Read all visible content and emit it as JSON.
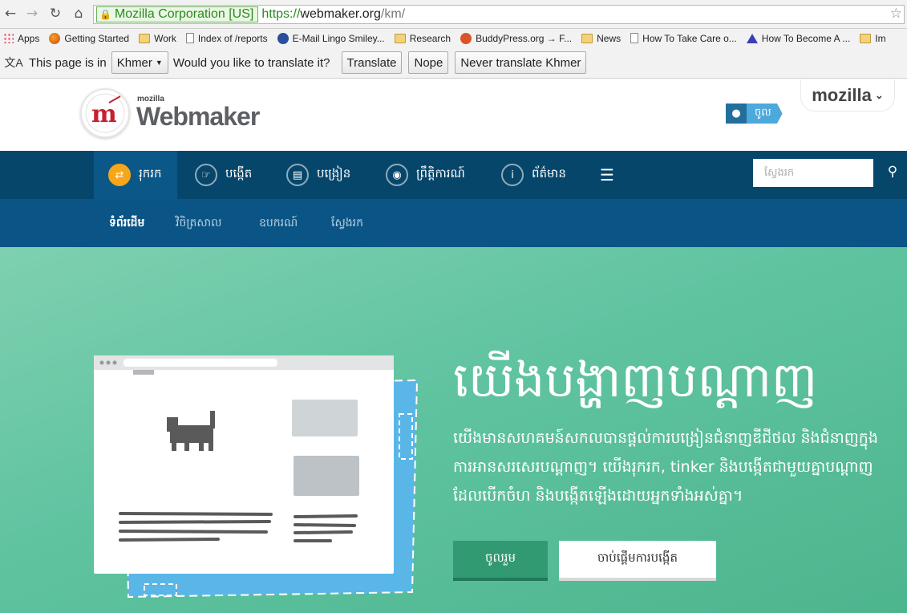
{
  "browser": {
    "ev_label": "Mozilla Corporation [US]",
    "url_scheme": "https://",
    "url_host": "webmaker.org",
    "url_path": "/km/",
    "back_icon": "back-arrow-icon",
    "forward_icon": "forward-arrow-icon",
    "reload_icon": "reload-icon",
    "home_icon": "home-icon",
    "star_icon": "bookmark-star-icon"
  },
  "bookmarks": [
    {
      "label": "Apps",
      "icon": "apps-grid-icon"
    },
    {
      "label": "Getting Started",
      "icon": "firefox-icon"
    },
    {
      "label": "Work",
      "icon": "folder-icon"
    },
    {
      "label": "Index of /reports",
      "icon": "page-icon"
    },
    {
      "label": "E-Mail Lingo Smiley...",
      "icon": "site-icon"
    },
    {
      "label": "Research",
      "icon": "folder-icon"
    },
    {
      "label": "BuddyPress.org → F...",
      "icon": "site-icon"
    },
    {
      "label": "News",
      "icon": "folder-icon"
    },
    {
      "label": "How To Take Care o...",
      "icon": "page-icon"
    },
    {
      "label": "How To Become A ...",
      "icon": "site-icon"
    },
    {
      "label": "Im",
      "icon": "folder-icon"
    }
  ],
  "translate_bar": {
    "prefix": "This page is in",
    "language": "Khmer",
    "question": "Would you like to translate it?",
    "translate_label": "Translate",
    "nope_label": "Nope",
    "never_label": "Never translate Khmer"
  },
  "header": {
    "logo_small": "mozilla",
    "logo_text": "Webmaker",
    "signin_label": "ចូល",
    "mozilla_label": "mozilla"
  },
  "primary_nav": {
    "explore": "រុករក",
    "make": "បង្កើត",
    "teach": "បង្រៀន",
    "events": "ព្រឹត្តិការណ៍",
    "about": "ព័ត៌មាន",
    "search_placeholder": "ស្វែងរក"
  },
  "secondary_nav": {
    "home": "ទំព័រដើម",
    "gallery": "វិចិត្រសាល",
    "tools": "ឧបករណ៍",
    "search": "ស្វែងរក"
  },
  "hero": {
    "title": "យើងបង្ហាញបណ្ដាញ",
    "body": "យើងមានសហគមន៍សកលបានផ្ដល់ការបង្រៀនជំនាញឌីជីថល និងជំនាញក្នុងការអានសរសេរបណ្ដាញ។ យើងរុករក, tinker និងបង្កើតជាមួយគ្នាបណ្ដាញដែលបើកចំហ និងបង្កើតឡើងដោយអ្នកទាំងអស់គ្នា។",
    "join_label": "ចូលរួម",
    "start_label": "ចាប់ផ្ដើមការបង្កើត"
  },
  "colors": {
    "nav_primary": "#07466b",
    "nav_secondary": "#0a5586",
    "hero_green": "#5fc3a0",
    "accent_orange": "#f7a51b",
    "brand_red": "#c8202f"
  }
}
